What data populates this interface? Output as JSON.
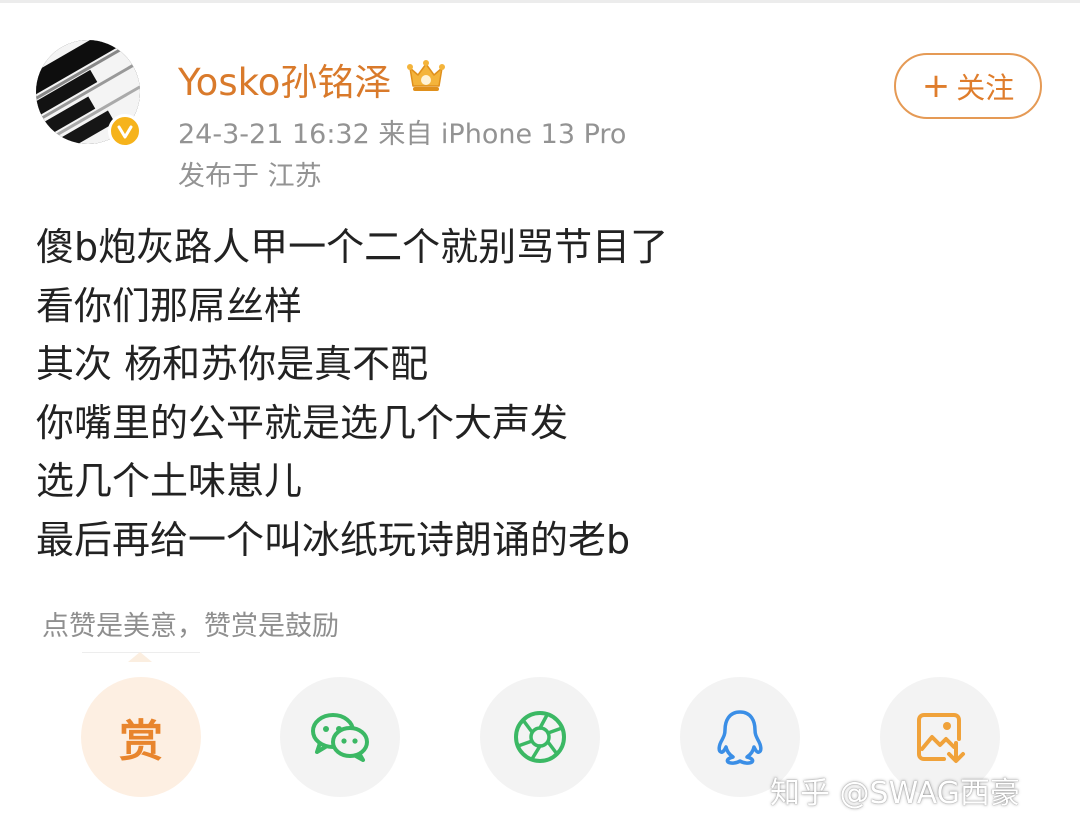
{
  "post": {
    "username": "Yosko孙铭泽",
    "meta": "24-3-21 16:32  来自 iPhone 13 Pro",
    "location": "发布于 江苏",
    "follow_label": "关注",
    "follow_plus": "+",
    "lines": [
      "傻b炮灰路人甲一个二个就别骂节目了",
      "看你们那屌丝样",
      "其次 杨和苏你是真不配",
      "你嘴里的公平就是选几个大声发",
      "选几个土味崽儿",
      "最后再给一个叫冰纸玩诗朗诵的老b"
    ]
  },
  "reward": {
    "tip": "点赞是美意，赞赏是鼓励",
    "button_char": "赏"
  },
  "share": {
    "icons": [
      "reward-icon",
      "wechat-icon",
      "moments-icon",
      "qq-icon",
      "save-image-icon"
    ]
  },
  "watermark": "知乎 @SWAG西豪",
  "colors": {
    "accent": "#df7d2c",
    "verified": "#f6b31b",
    "wechat": "#3bb864",
    "qq": "#3a8ee6",
    "save": "#f0a23a"
  }
}
